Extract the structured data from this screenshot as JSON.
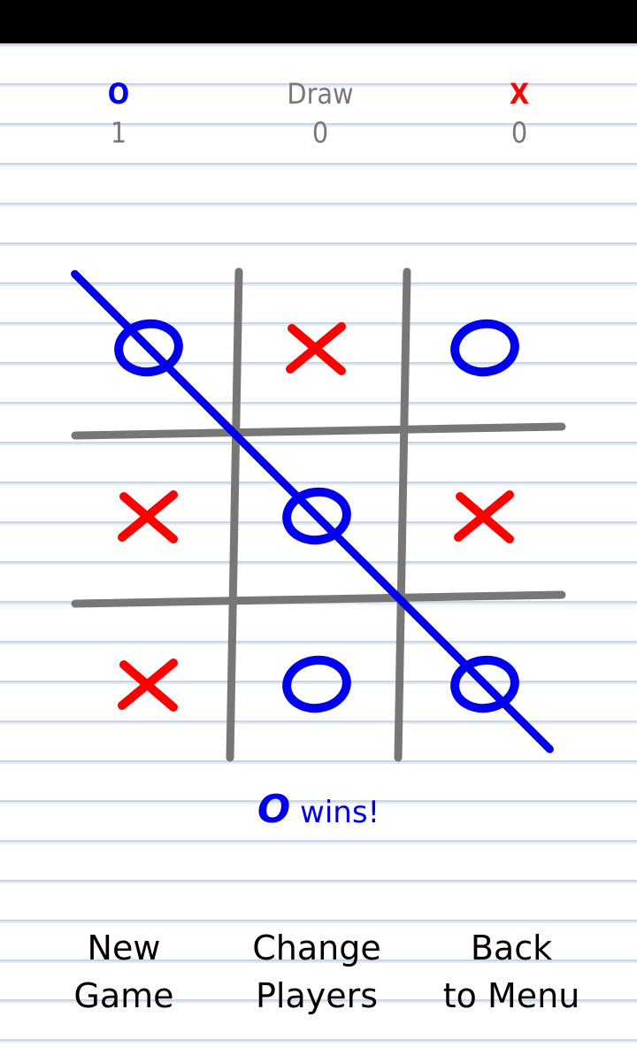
{
  "colors": {
    "o": "#0000ee",
    "x": "#ff0000",
    "grid": "#777777",
    "paper_line": "#c9d6e6",
    "text": "#000000"
  },
  "scoreboard": {
    "o": {
      "label": "O",
      "value": "1"
    },
    "draw": {
      "label": "Draw",
      "value": "0"
    },
    "x": {
      "label": "X",
      "value": "0"
    }
  },
  "board": {
    "cells": [
      "O",
      "X",
      "O",
      "X",
      "O",
      "X",
      "X",
      "O",
      "O"
    ],
    "winning_line": [
      0,
      4,
      8
    ],
    "winner": "O"
  },
  "result": {
    "mark": "O",
    "text": "wins!"
  },
  "buttons": {
    "new_game": [
      "New",
      "Game"
    ],
    "change_players": [
      "Change",
      "Players"
    ],
    "back_to_menu": [
      "Back",
      "to Menu"
    ]
  }
}
